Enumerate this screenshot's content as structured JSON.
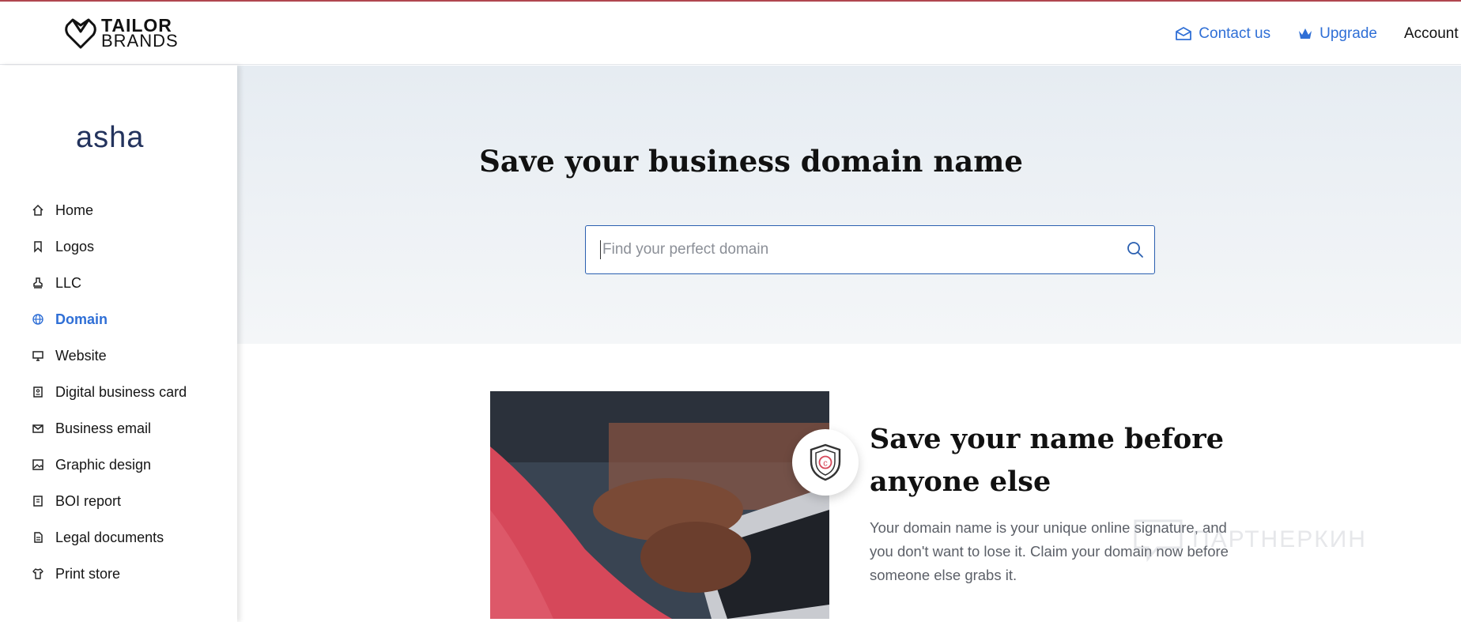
{
  "header": {
    "brand_line1": "TAILOR",
    "brand_line2": "BRANDS",
    "contact_label": "Contact us",
    "upgrade_label": "Upgrade",
    "account_label": "Account"
  },
  "sidebar": {
    "business_name": "asha",
    "items": [
      {
        "label": "Home",
        "icon": "home-icon"
      },
      {
        "label": "Logos",
        "icon": "bookmark-icon"
      },
      {
        "label": "LLC",
        "icon": "stamp-icon"
      },
      {
        "label": "Domain",
        "icon": "globe-icon",
        "active": true
      },
      {
        "label": "Website",
        "icon": "monitor-icon"
      },
      {
        "label": "Digital business card",
        "icon": "id-card-icon"
      },
      {
        "label": "Business email",
        "icon": "mail-icon"
      },
      {
        "label": "Graphic design",
        "icon": "image-icon"
      },
      {
        "label": "BOI report",
        "icon": "report-icon"
      },
      {
        "label": "Legal documents",
        "icon": "document-icon"
      },
      {
        "label": "Print store",
        "icon": "tshirt-icon"
      }
    ]
  },
  "hero": {
    "title": "Save your business domain name",
    "search_placeholder": "Find your perfect domain"
  },
  "feature": {
    "title": "Save your name before anyone else",
    "text": "Your domain name is your unique online signature, and you don't want to lose it. Claim your domain now before someone else grabs it."
  },
  "watermark": {
    "text": "ПАРТНЕРКИН"
  },
  "colors": {
    "accent": "#2f6fd6",
    "brand_navy": "#23335d",
    "top_line": "#b0464f"
  }
}
